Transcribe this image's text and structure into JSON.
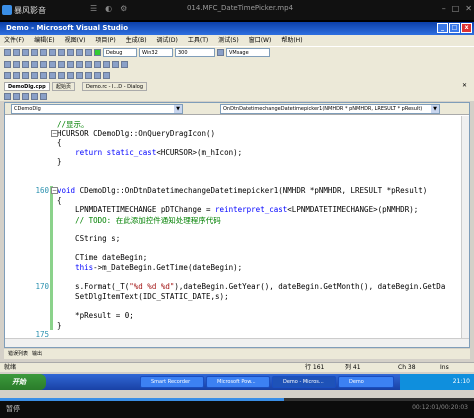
{
  "player": {
    "logo_text": "暴风影音",
    "title": "014.MFC_DateTimePicker.mp4",
    "pause_label": "暂停",
    "time": "00:12:01/00:20:03",
    "progress": 0.6
  },
  "ide": {
    "window_title": "Demo - Microsoft Visual Studio",
    "menu": [
      "文件(F)",
      "编辑(E)",
      "视图(V)",
      "项目(P)",
      "生成(B)",
      "调试(D)",
      "工具(T)",
      "测试(S)",
      "窗口(W)",
      "帮助(H)"
    ],
    "toolbar": {
      "config": "Debug",
      "platform": "Win32",
      "zoom": "300",
      "find": "VMsage"
    },
    "doc_tabs": [
      "DemoDlg.cpp",
      "起始页",
      "Demo.rc - I...D - Dialog"
    ],
    "class_combo": "CDemoDlg",
    "method_combo": "OnDtnDatetimechangeDatetimepicker1(NMHDR * pNMHDR, LRESULT * pResult)",
    "output_tabs": [
      "错误列表",
      "输出"
    ],
    "status": {
      "left": "就绪",
      "ln": "行 161",
      "col": "列 41",
      "ch": "Ch 38",
      "mode": "Ins"
    }
  },
  "code": {
    "lines": [
      {
        "n": "",
        "text": "//显示。"
      },
      {
        "n": "",
        "text": "HCURSOR CDemoDlg::OnQueryDragIcon()"
      },
      {
        "n": "",
        "text": "{"
      },
      {
        "n": "",
        "text": "    return static_cast<HCURSOR>(m_hIcon);"
      },
      {
        "n": "",
        "text": "}"
      },
      {
        "n": "",
        "text": ""
      },
      {
        "n": "",
        "text": ""
      },
      {
        "n": "160",
        "text": "void CDemoDlg::OnDtnDatetimechangeDatetimepicker1(NMHDR *pNMHDR, LRESULT *pResult)"
      },
      {
        "n": "",
        "text": "{"
      },
      {
        "n": "",
        "text": "    LPNMDATETIMECHANGE pDTChange = reinterpret_cast<LPNMDATETIMECHANGE>(pNMHDR);"
      },
      {
        "n": "",
        "text": "    // TODO: 在此添加控件通知处理程序代码"
      },
      {
        "n": "",
        "text": ""
      },
      {
        "n": "",
        "text": "    CString s;"
      },
      {
        "n": "",
        "text": ""
      },
      {
        "n": "",
        "text": "    CTime dateBegin;"
      },
      {
        "n": "",
        "text": "    this->m_DateBegin.GetTime(dateBegin);"
      },
      {
        "n": "",
        "text": ""
      },
      {
        "n": "170",
        "text": "    s.Format(_T(\"%d %d %d\"),dateBegin.GetYear(), dateBegin.GetMonth(), dateBegin.GetDa"
      },
      {
        "n": "",
        "text": "    SetDlgItemText(IDC_STATIC_DATE,s);"
      },
      {
        "n": "",
        "text": ""
      },
      {
        "n": "",
        "text": "    *pResult = 0;"
      },
      {
        "n": "",
        "text": "}"
      },
      {
        "n": "175",
        "text": ""
      }
    ]
  },
  "taskbar": {
    "start": "开始",
    "buttons": [
      "Smart Recorder",
      "Microsoft Pow...",
      "Demo - Micros...",
      "Demo"
    ],
    "clock": "21:10"
  },
  "colors": {
    "keyword": "#0000ff",
    "comment": "#008000",
    "string": "#a31515",
    "line_number": "#2b91af"
  }
}
